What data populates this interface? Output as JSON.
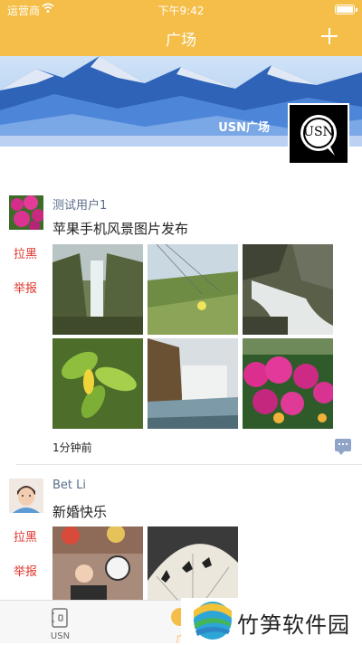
{
  "status_bar": {
    "carrier": "运营商",
    "time": "下午9:42"
  },
  "nav": {
    "title": "广场",
    "add_icon": "plus-icon"
  },
  "banner": {
    "name": "USN广场",
    "logo_text": "USN"
  },
  "posts": [
    {
      "user": "测试用户1",
      "text": "苹果手机风景图片发布",
      "block": "拉黑",
      "report": "举报",
      "time": "1分钟前"
    },
    {
      "user": "Bet Li",
      "text": "新婚快乐",
      "block": "拉黑",
      "report": "举报"
    }
  ],
  "tabs": [
    {
      "label": "USN",
      "icon": "notebook-icon"
    },
    {
      "label": "广",
      "icon": "square-icon"
    }
  ],
  "watermark": {
    "text": "竹笋软件园"
  },
  "colors": {
    "accent": "#F4BE48",
    "link": "#5A6E8C",
    "danger": "#E0352B"
  }
}
